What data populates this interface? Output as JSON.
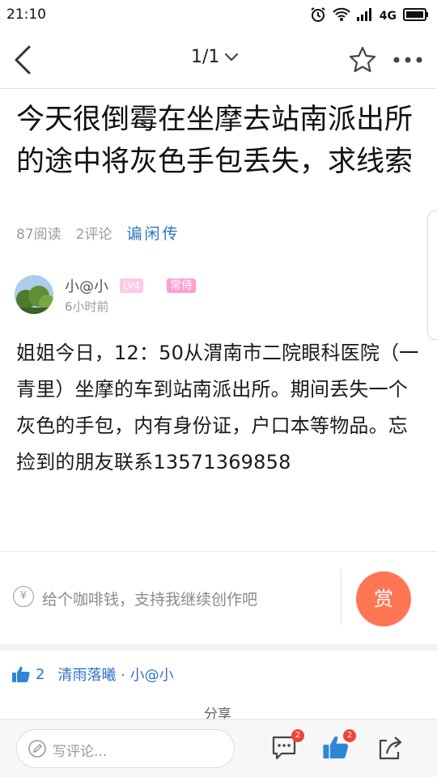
{
  "status_bar": {
    "time": "21:10",
    "network": "4G",
    "icons": [
      "alarm-icon",
      "wifi-icon",
      "signal-icon",
      "battery-icon"
    ]
  },
  "nav": {
    "page_indicator": "1/1",
    "icons": [
      "back-icon",
      "chevron-down-icon",
      "star-icon",
      "more-icon"
    ]
  },
  "article": {
    "title": "今天很倒霉在坐摩去站南派出所的途中将灰色手包丢失，求线索",
    "reads": "87阅读",
    "comments": "2评论",
    "category": "谝闲传",
    "body": "姐姐今日，12：50从渭南市二院眼科医院（一青里）坐摩的车到站南派出所。期间丢失一个灰色的手包，内有身份证，户口本等物品。忘捡到的朋友联系13571369858"
  },
  "author": {
    "name": "小@小",
    "level_badge": "LV4",
    "role_badge": "常侍",
    "time": "6小时前"
  },
  "tip": {
    "currency_symbol": "¥",
    "text": "给个咖啡钱，支持我继续创作吧",
    "reward_label": "赏"
  },
  "likes": {
    "count": "2",
    "users": "清雨落曦 · 小@小"
  },
  "share_label": "分享",
  "bottom_bar": {
    "comment_placeholder": "写评论...",
    "comment_badge": "2",
    "like_badge": "2"
  },
  "colors": {
    "link_blue": "#2f72c4",
    "reward_orange": "#ff7654",
    "badge_pink": "#ff9fd0",
    "notification_red": "#f0443c"
  }
}
